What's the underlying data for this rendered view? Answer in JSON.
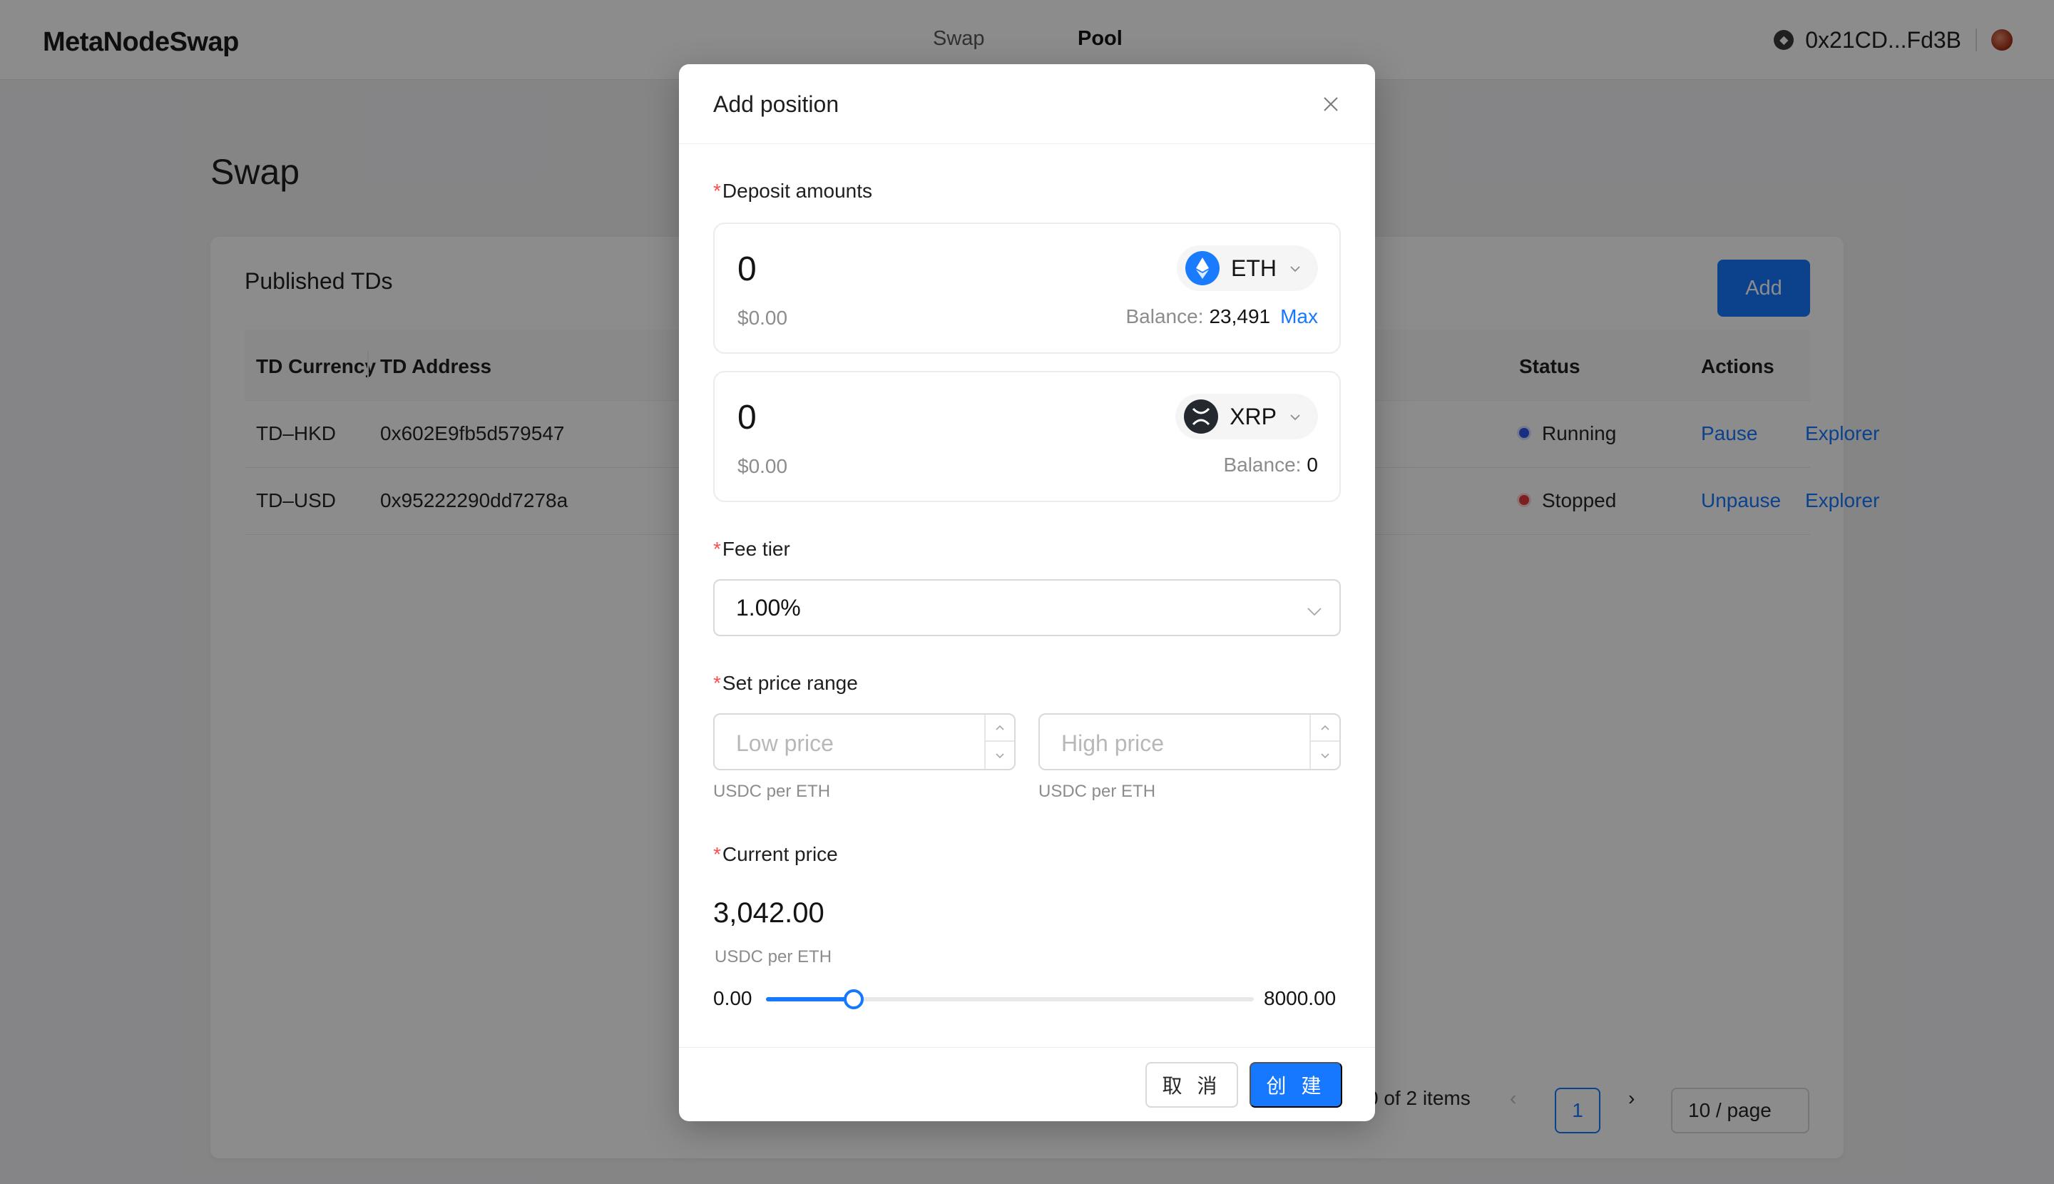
{
  "app": {
    "brand": "MetaNodeSwap",
    "nav": {
      "swap": "Swap",
      "pool": "Pool"
    },
    "wallet": {
      "address": "0x21CD...Fd3B",
      "chain_icon": "network-icon",
      "avatar_icon": "avatar-icon"
    }
  },
  "page": {
    "title": "Swap",
    "card_title": "Published TDs",
    "add_label": "Add",
    "columns": [
      "TD Currency",
      "TD Address",
      "Status",
      "Actions"
    ],
    "rows": [
      {
        "currency": "TD–HKD",
        "address": "0x602E9fb5d579547",
        "status": "Running",
        "status_color": "#2f54eb",
        "action1": "Pause",
        "action2": "Explorer"
      },
      {
        "currency": "TD–USD",
        "address": "0x95222290dd7278a",
        "status": "Stopped",
        "status_color": "#e03a3a",
        "action1": "Unpause",
        "action2": "Explorer"
      }
    ],
    "pagination": {
      "total_text": "0 of 2 items",
      "current_page": "1",
      "page_size": "10 / page"
    }
  },
  "modal": {
    "title": "Add position",
    "deposit_label": "Deposit amounts",
    "token0": {
      "amount": "0",
      "usd": "$0.00",
      "symbol": "ETH",
      "balance_label": "Balance:",
      "balance": "23,491",
      "max_label": "Max",
      "icon": "eth-icon"
    },
    "token1": {
      "amount": "0",
      "usd": "$0.00",
      "symbol": "XRP",
      "balance_label": "Balance:",
      "balance": "0",
      "icon": "xrp-icon"
    },
    "fee_label": "Fee tier",
    "fee_value": "1.00%",
    "range_label": "Set price range",
    "low_placeholder": "Low price",
    "high_placeholder": "High price",
    "unit": "USDC per ETH",
    "current_label": "Current price",
    "current_price": "3,042.00",
    "slider": {
      "min": "0.00",
      "max": "8000.00",
      "value": 3042,
      "max_value": 8000,
      "fill_fraction": 0.18
    },
    "cancel_label": "取 消",
    "ok_label": "创 建"
  },
  "colors": {
    "accent": "#1677ff",
    "required": "#ff4d4f",
    "overlay": "rgba(0,0,0,0.45)"
  }
}
